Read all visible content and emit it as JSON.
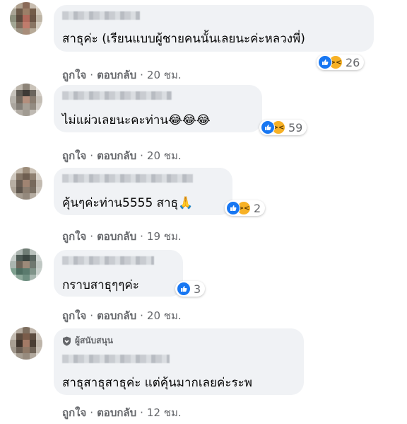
{
  "comments": [
    {
      "text": "สาธุค่ะ (เรียนแบบผู้ชายคนนั้นเลยนะค่ะหลวงพี่)",
      "reaction_count": "26",
      "reactions": [
        "like",
        "haha"
      ],
      "like_label": "ถูกใจ",
      "reply_label": "ตอบกลับ",
      "time": "20 ชม."
    },
    {
      "text": "ไม่แผ่วเลยนะคะท่าน😂😂😂",
      "reaction_count": "59",
      "reactions": [
        "like",
        "haha"
      ],
      "like_label": "ถูกใจ",
      "reply_label": "ตอบกลับ",
      "time": "20 ชม."
    },
    {
      "text": "คุ้นๆค่ะท่าน5555 สาธุ🙏",
      "reaction_count": "2",
      "reactions": [
        "like",
        "haha"
      ],
      "like_label": "ถูกใจ",
      "reply_label": "ตอบกลับ",
      "time": "19 ชม."
    },
    {
      "text": "กราบสาธุๆๆค่ะ",
      "reaction_count": "3",
      "reactions": [
        "like"
      ],
      "like_label": "ถูกใจ",
      "reply_label": "ตอบกลับ",
      "time": "20 ชม."
    },
    {
      "text": "สาธุสาธุสาธุค่ะ แต่คุ้นมากเลยค่ะระพ",
      "badge": "ผู้สนับสนุน",
      "like_label": "ถูกใจ",
      "reply_label": "ตอบกลับ",
      "time": "12 ชม."
    }
  ],
  "colors": {
    "bubble": "#f0f2f5",
    "like": "#1877f2",
    "haha": "#f7b125",
    "meta": "#65676b"
  },
  "icons": [
    "like-icon",
    "haha-icon",
    "supporter-badge-icon"
  ]
}
